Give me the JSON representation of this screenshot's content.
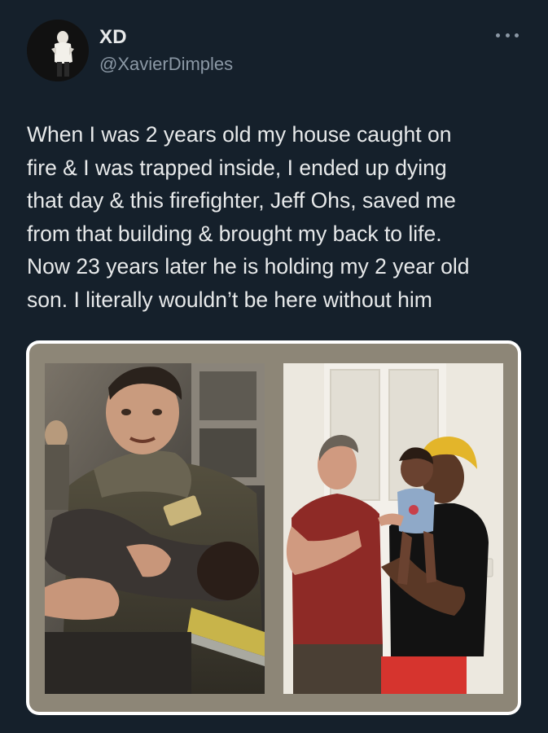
{
  "author": {
    "display_name": "XD",
    "handle": "@XavierDimples",
    "avatar_icon": "profile-avatar"
  },
  "menu": {
    "icon": "more-options-icon"
  },
  "tweet": {
    "lines": [
      "When I was 2 years old my house caught on",
      "fire & I was trapped inside, I ended up dying",
      "that day & this firefighter, Jeff Ohs, saved me",
      "from that building & brought my back to life.",
      "Now 23 years later he is holding my 2 year old",
      "son. I literally wouldn’t be here without him"
    ]
  },
  "media": {
    "frame_color": "#8d8677",
    "photos": [
      "firefighter-rescue-photo",
      "reunion-photo"
    ]
  },
  "colors": {
    "background": "#15202b",
    "text": "#e7e9ea",
    "muted": "#8b98a5"
  }
}
